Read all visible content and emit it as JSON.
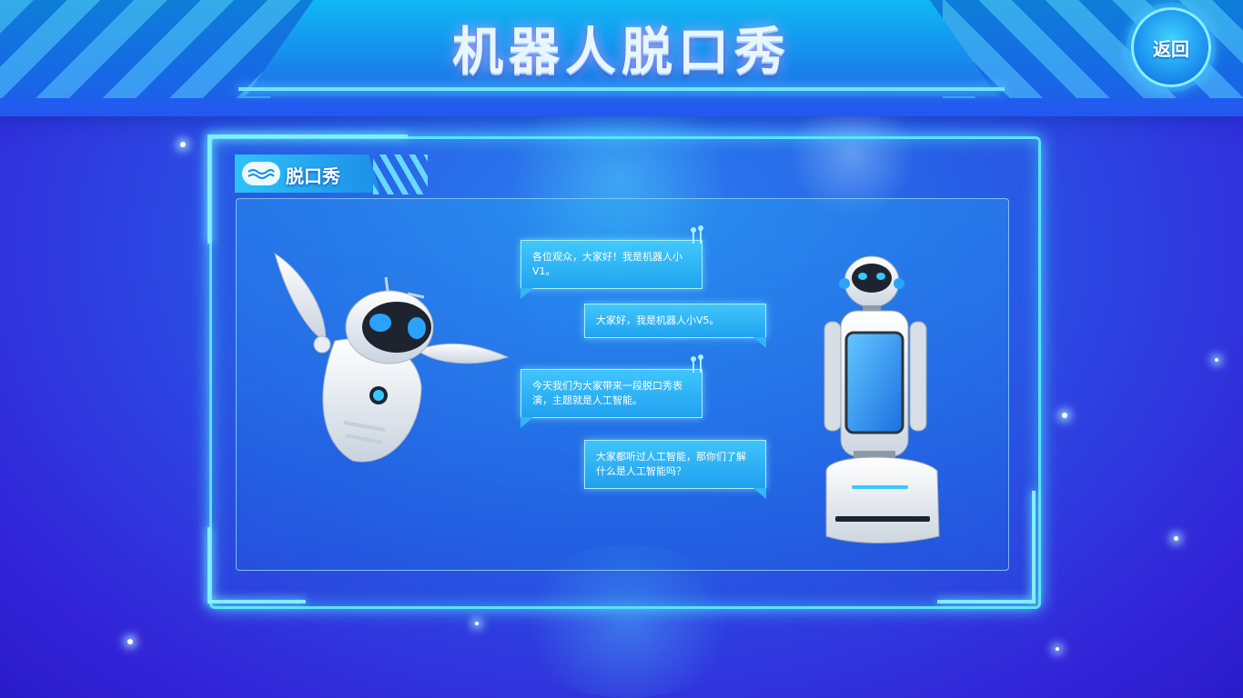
{
  "header": {
    "title": "机器人脱口秀",
    "back_label": "返回"
  },
  "panel": {
    "title": "脱口秀"
  },
  "dialogue": [
    {
      "speaker": "V1",
      "text": "各位观众，大家好！我是机器人小V1。"
    },
    {
      "speaker": "V5",
      "text": "大家好，我是机器人小V5。"
    },
    {
      "speaker": "V1",
      "text": "今天我们为大家带来一段脱口秀表演，主题就是人工智能。"
    },
    {
      "speaker": "V5",
      "text": "大家都听过人工智能，那你们了解什么是人工智能吗？"
    }
  ],
  "colors": {
    "accent": "#58e4ff",
    "bubble": "#33b6f2",
    "background": "#2a55e6"
  },
  "icons": {
    "back": "back-button-icon",
    "tab": "wave-icon"
  }
}
